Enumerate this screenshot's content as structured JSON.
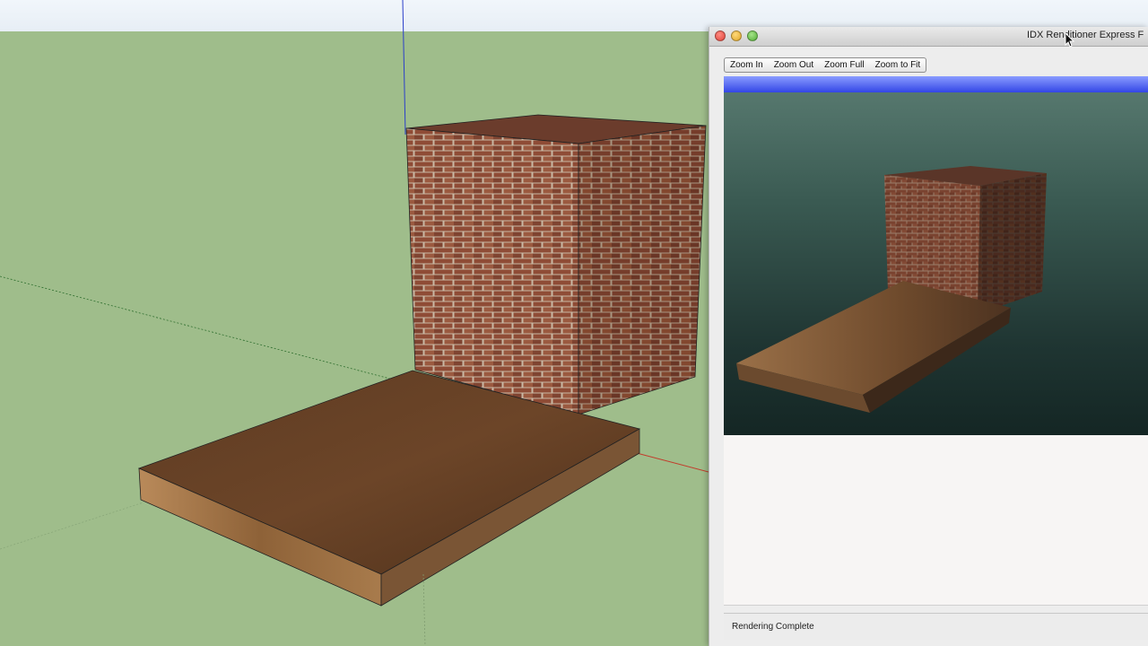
{
  "window": {
    "title": "IDX Renditioner Express F"
  },
  "toolbar": {
    "zoom_in": "Zoom In",
    "zoom_out": "Zoom Out",
    "zoom_full": "Zoom Full",
    "zoom_to_fit": "Zoom to Fit"
  },
  "status": {
    "text": "Rendering Complete"
  },
  "colors": {
    "sketchup_ground": "#9fbd8b",
    "sketchup_sky": "#eef3f8",
    "render_progress": "#3346e6",
    "brick": "#8c4a35",
    "wood": "#7a5234"
  },
  "icons": {
    "close": "close-icon",
    "minimize": "minimize-icon",
    "maximize": "maximize-icon",
    "cursor": "pointer-cursor-icon"
  }
}
